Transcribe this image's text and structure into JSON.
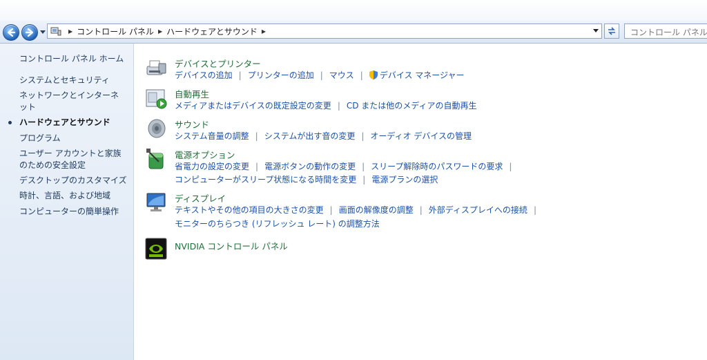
{
  "address": {
    "crumbs": [
      "コントロール パネル",
      "ハードウェアとサウンド"
    ],
    "search_placeholder": "コントロール パネルの検索"
  },
  "sidebar": {
    "home": "コントロール パネル ホーム",
    "items": [
      {
        "label": "システムとセキュリティ"
      },
      {
        "label": "ネットワークとインターネット"
      },
      {
        "label": "ハードウェアとサウンド",
        "active": true
      },
      {
        "label": "プログラム"
      },
      {
        "label": "ユーザー アカウントと家族のための安全設定"
      },
      {
        "label": "デスクトップのカスタマイズ"
      },
      {
        "label": "時計、言語、および地域"
      },
      {
        "label": "コンピューターの簡単操作"
      }
    ]
  },
  "categories": [
    {
      "title": "デバイスとプリンター",
      "icon": "printer-icon",
      "links": [
        "デバイスの追加",
        "プリンターの追加",
        "マウス",
        "デバイス マネージャー"
      ]
    },
    {
      "title": "自動再生",
      "icon": "autoplay-icon",
      "links": [
        "メディアまたはデバイスの既定設定の変更",
        "CD または他のメディアの自動再生"
      ]
    },
    {
      "title": "サウンド",
      "icon": "speaker-icon",
      "links": [
        "システム音量の調整",
        "システムが出す音の変更",
        "オーディオ デバイスの管理"
      ]
    },
    {
      "title": "電源オプション",
      "icon": "power-icon",
      "links": [
        "省電力の設定の変更",
        "電源ボタンの動作の変更",
        "スリープ解除時のパスワードの要求",
        "コンピューターがスリープ状態になる時間を変更",
        "電源プランの選択"
      ]
    },
    {
      "title": "ディスプレイ",
      "icon": "display-icon",
      "links": [
        "テキストやその他の項目の大きさの変更",
        "画面の解像度の調整",
        "外部ディスプレイへの接続",
        "モニターのちらつき (リフレッシュ レート) の調整方法"
      ]
    },
    {
      "title": "NVIDIA コントロール パネル",
      "icon": "nvidia-icon",
      "links": []
    }
  ],
  "colors": {
    "link": "#1c52a8",
    "category_title": "#1f6d36",
    "sidebar_bg": "#e6eef8"
  }
}
